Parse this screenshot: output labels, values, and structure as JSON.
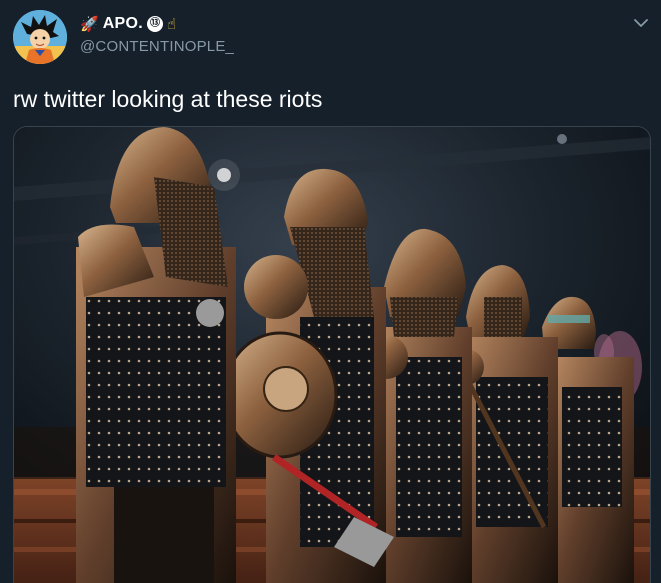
{
  "tweet": {
    "author": {
      "display_name": "APO.",
      "handle": "@CONTENTINOPLE_",
      "name_emojis": {
        "rocket": "🚀",
        "badge": "⑬",
        "finger": "☝"
      }
    },
    "text": "rw twitter looking at these riots",
    "icons": {
      "menu": "chevron-down-icon",
      "avatar": "avatar-image"
    },
    "colors": {
      "background": "#15202b",
      "secondary_text": "#8899a6",
      "border": "#38444d"
    }
  }
}
